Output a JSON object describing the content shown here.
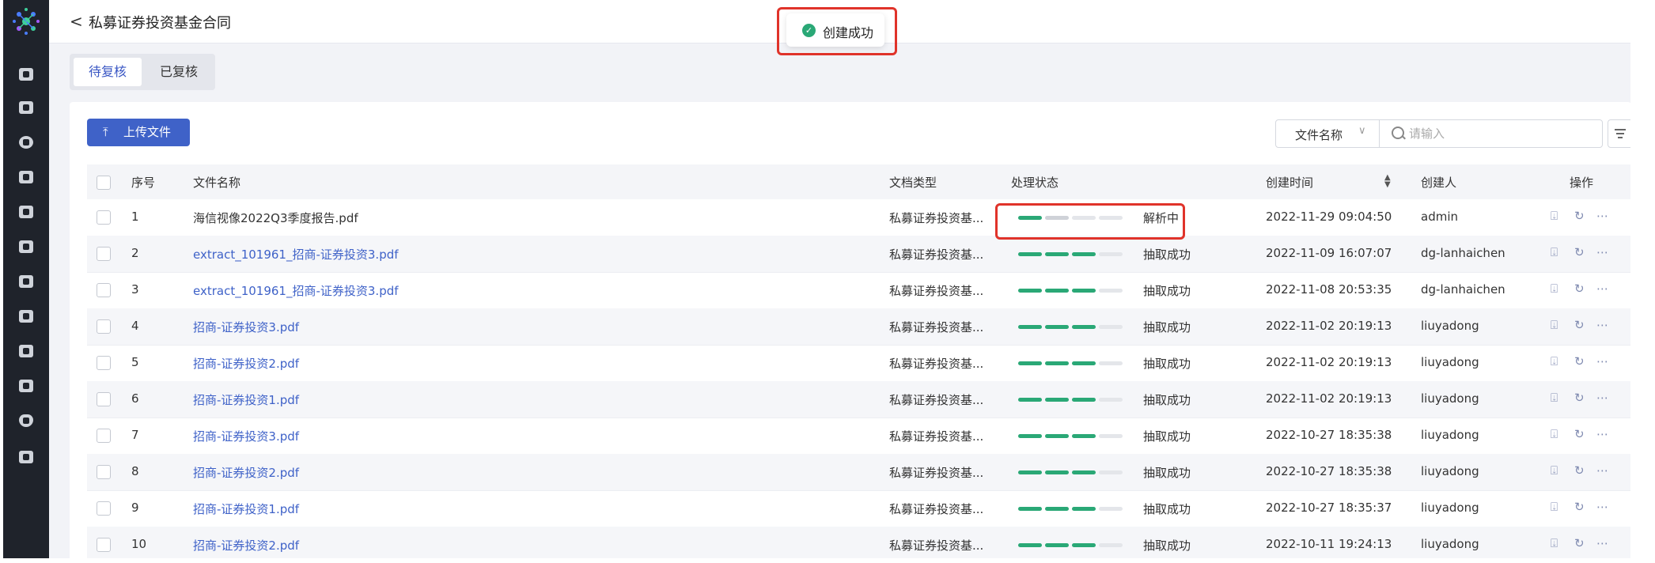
{
  "header": {
    "title": "私募证券投资基金合同"
  },
  "toast": {
    "text": "创建成功",
    "icon": "check-circle-icon",
    "color": "#2aa876"
  },
  "tabs": [
    {
      "label": "待复核",
      "active": true
    },
    {
      "label": "已复核",
      "active": false
    }
  ],
  "toolbar": {
    "upload_label": "上传文件",
    "search_field": "文件名称",
    "search_placeholder": "请输入"
  },
  "table": {
    "columns": {
      "index": "序号",
      "name": "文件名称",
      "type": "文档类型",
      "status": "处理状态",
      "created": "创建时间",
      "creator": "创建人",
      "actions": "操作"
    },
    "rows": [
      {
        "index": "1",
        "name": "海信视像2022Q3季度报告.pdf",
        "link": false,
        "type": "私募证券投资基...",
        "status": "解析中",
        "progress_steps": 2,
        "created": "2022-11-29 09:04:50",
        "creator": "admin"
      },
      {
        "index": "2",
        "name": "extract_101961_招商-证券投资3.pdf",
        "link": true,
        "type": "私募证券投资基...",
        "status": "抽取成功",
        "progress_steps": 3,
        "created": "2022-11-09 16:07:07",
        "creator": "dg-lanhaichen"
      },
      {
        "index": "3",
        "name": "extract_101961_招商-证券投资3.pdf",
        "link": true,
        "type": "私募证券投资基...",
        "status": "抽取成功",
        "progress_steps": 3,
        "created": "2022-11-08 20:53:35",
        "creator": "dg-lanhaichen"
      },
      {
        "index": "4",
        "name": "招商-证券投资3.pdf",
        "link": true,
        "type": "私募证券投资基...",
        "status": "抽取成功",
        "progress_steps": 3,
        "created": "2022-11-02 20:19:13",
        "creator": "liuyadong"
      },
      {
        "index": "5",
        "name": "招商-证券投资2.pdf",
        "link": true,
        "type": "私募证券投资基...",
        "status": "抽取成功",
        "progress_steps": 3,
        "created": "2022-11-02 20:19:13",
        "creator": "liuyadong"
      },
      {
        "index": "6",
        "name": "招商-证券投资1.pdf",
        "link": true,
        "type": "私募证券投资基...",
        "status": "抽取成功",
        "progress_steps": 3,
        "created": "2022-11-02 20:19:13",
        "creator": "liuyadong"
      },
      {
        "index": "7",
        "name": "招商-证券投资3.pdf",
        "link": true,
        "type": "私募证券投资基...",
        "status": "抽取成功",
        "progress_steps": 3,
        "created": "2022-10-27 18:35:38",
        "creator": "liuyadong"
      },
      {
        "index": "8",
        "name": "招商-证券投资2.pdf",
        "link": true,
        "type": "私募证券投资基...",
        "status": "抽取成功",
        "progress_steps": 3,
        "created": "2022-10-27 18:35:38",
        "creator": "liuyadong"
      },
      {
        "index": "9",
        "name": "招商-证券投资1.pdf",
        "link": true,
        "type": "私募证券投资基...",
        "status": "抽取成功",
        "progress_steps": 3,
        "created": "2022-10-27 18:35:37",
        "creator": "liuyadong"
      },
      {
        "index": "10",
        "name": "招商-证券投资2.pdf",
        "link": true,
        "type": "私募证券投资基...",
        "status": "抽取成功",
        "progress_steps": 3,
        "created": "2022-10-11 19:24:13",
        "creator": "liuyadong"
      }
    ]
  },
  "colors": {
    "accent": "#3f62c8",
    "progress_done": "#2aa876",
    "progress_pending": "#cfd2d8",
    "highlight": "#e0332a",
    "sidebar": "#1f232b"
  }
}
